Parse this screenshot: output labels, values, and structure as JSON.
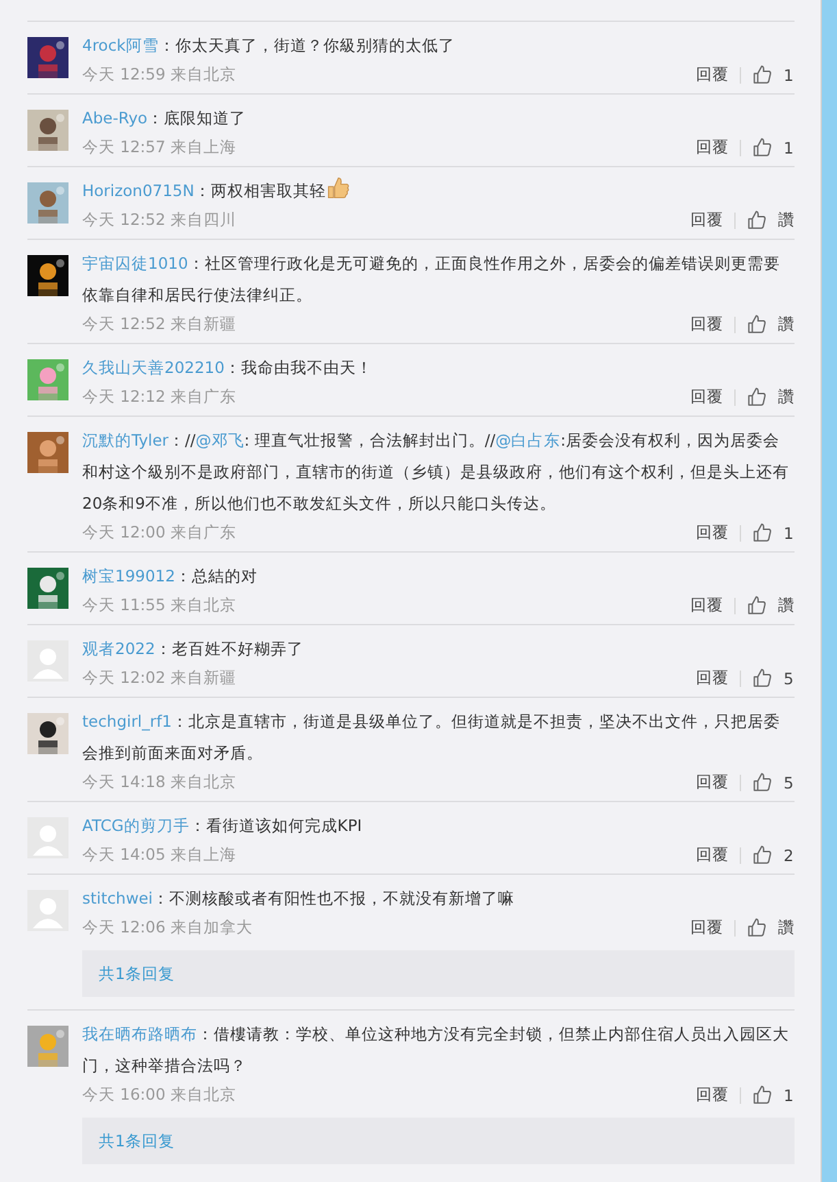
{
  "comments": [
    {
      "name": "4rock阿雪",
      "segments": [
        {
          "kind": "text",
          "text": "：你太天真了，街道？你級别猜的太低了"
        }
      ],
      "meta": "今天 12:59 来自北京",
      "reply": "回覆",
      "like": "1"
    },
    {
      "name": "Abe-Ryo",
      "segments": [
        {
          "kind": "text",
          "text": "：底限知道了"
        }
      ],
      "meta": "今天 12:57 来自上海",
      "reply": "回覆",
      "like": "1"
    },
    {
      "name": "Horizon0715N",
      "segments": [
        {
          "kind": "text",
          "text": "：两权相害取其轻"
        },
        {
          "kind": "emoji"
        }
      ],
      "meta": "今天 12:52 来自四川",
      "reply": "回覆",
      "like": "讚"
    },
    {
      "name": "宇宙囚徒1010",
      "segments": [
        {
          "kind": "text",
          "text": "：社区管理行政化是无可避免的，正面良性作用之外，居委会的偏差错误则更需要依靠自律和居民行使法律纠正。"
        }
      ],
      "meta": "今天 12:52 来自新疆",
      "reply": "回覆",
      "like": "讚"
    },
    {
      "name": "久我山天善202210",
      "segments": [
        {
          "kind": "text",
          "text": "：我命由我不由天！"
        }
      ],
      "meta": "今天 12:12 来自广东",
      "reply": "回覆",
      "like": "讚"
    },
    {
      "name": "沉默的Tyler",
      "segments": [
        {
          "kind": "text",
          "text": "：//"
        },
        {
          "kind": "mention",
          "text": "@邓飞"
        },
        {
          "kind": "text",
          "text": ": 理直气壮报警，合法解封出门。//"
        },
        {
          "kind": "mention",
          "text": "@白占东"
        },
        {
          "kind": "text",
          "text": ":居委会没有权利，因为居委会和村这个級别不是政府部门，直辖市的街道（乡镇）是县级政府，他们有这个权利，但是头上还有20条和9不准，所以他们也不敢发紅头文件，所以只能口头传达。"
        }
      ],
      "meta": "今天 12:00 来自广东",
      "reply": "回覆",
      "like": "1"
    },
    {
      "name": "树宝199012",
      "segments": [
        {
          "kind": "text",
          "text": "：总結的对"
        }
      ],
      "meta": "今天 11:55 来自北京",
      "reply": "回覆",
      "like": "讚"
    },
    {
      "kind": "default",
      "name": "观者2022",
      "segments": [
        {
          "kind": "text",
          "text": "：老百姓不好糊弄了"
        }
      ],
      "meta": "今天 12:02 来自新疆",
      "reply": "回覆",
      "like": "5"
    },
    {
      "name": "techgirl_rf1",
      "segments": [
        {
          "kind": "text",
          "text": "：北京是直辖市，街道是县级单位了。但街道就是不担责，坚决不出文件，只把居委会推到前面来面对矛盾。"
        }
      ],
      "meta": "今天 14:18 来自北京",
      "reply": "回覆",
      "like": "5"
    },
    {
      "kind": "default",
      "name": "ATCG的剪刀手",
      "segments": [
        {
          "kind": "text",
          "text": "：看街道该如何完成KPI"
        }
      ],
      "meta": "今天 14:05 来自上海",
      "reply": "回覆",
      "like": "2"
    },
    {
      "kind": "default",
      "name": "stitchwei",
      "segments": [
        {
          "kind": "text",
          "text": "：不测核酸或者有阳性也不报，不就没有新增了嘛"
        }
      ],
      "meta": "今天 12:06 来自加拿大",
      "reply": "回覆",
      "like": "讚",
      "replies": "共1条回复"
    },
    {
      "name": "我在晒布路晒布",
      "segments": [
        {
          "kind": "text",
          "text": "：借樓请教：学校、单位这种地方没有完全封锁，但禁止内部住宿人员出入园区大门，这种举措合法吗？"
        }
      ],
      "meta": "今天 16:00 来自北京",
      "reply": "回覆",
      "like": "1",
      "replies": "共1条回复"
    }
  ]
}
